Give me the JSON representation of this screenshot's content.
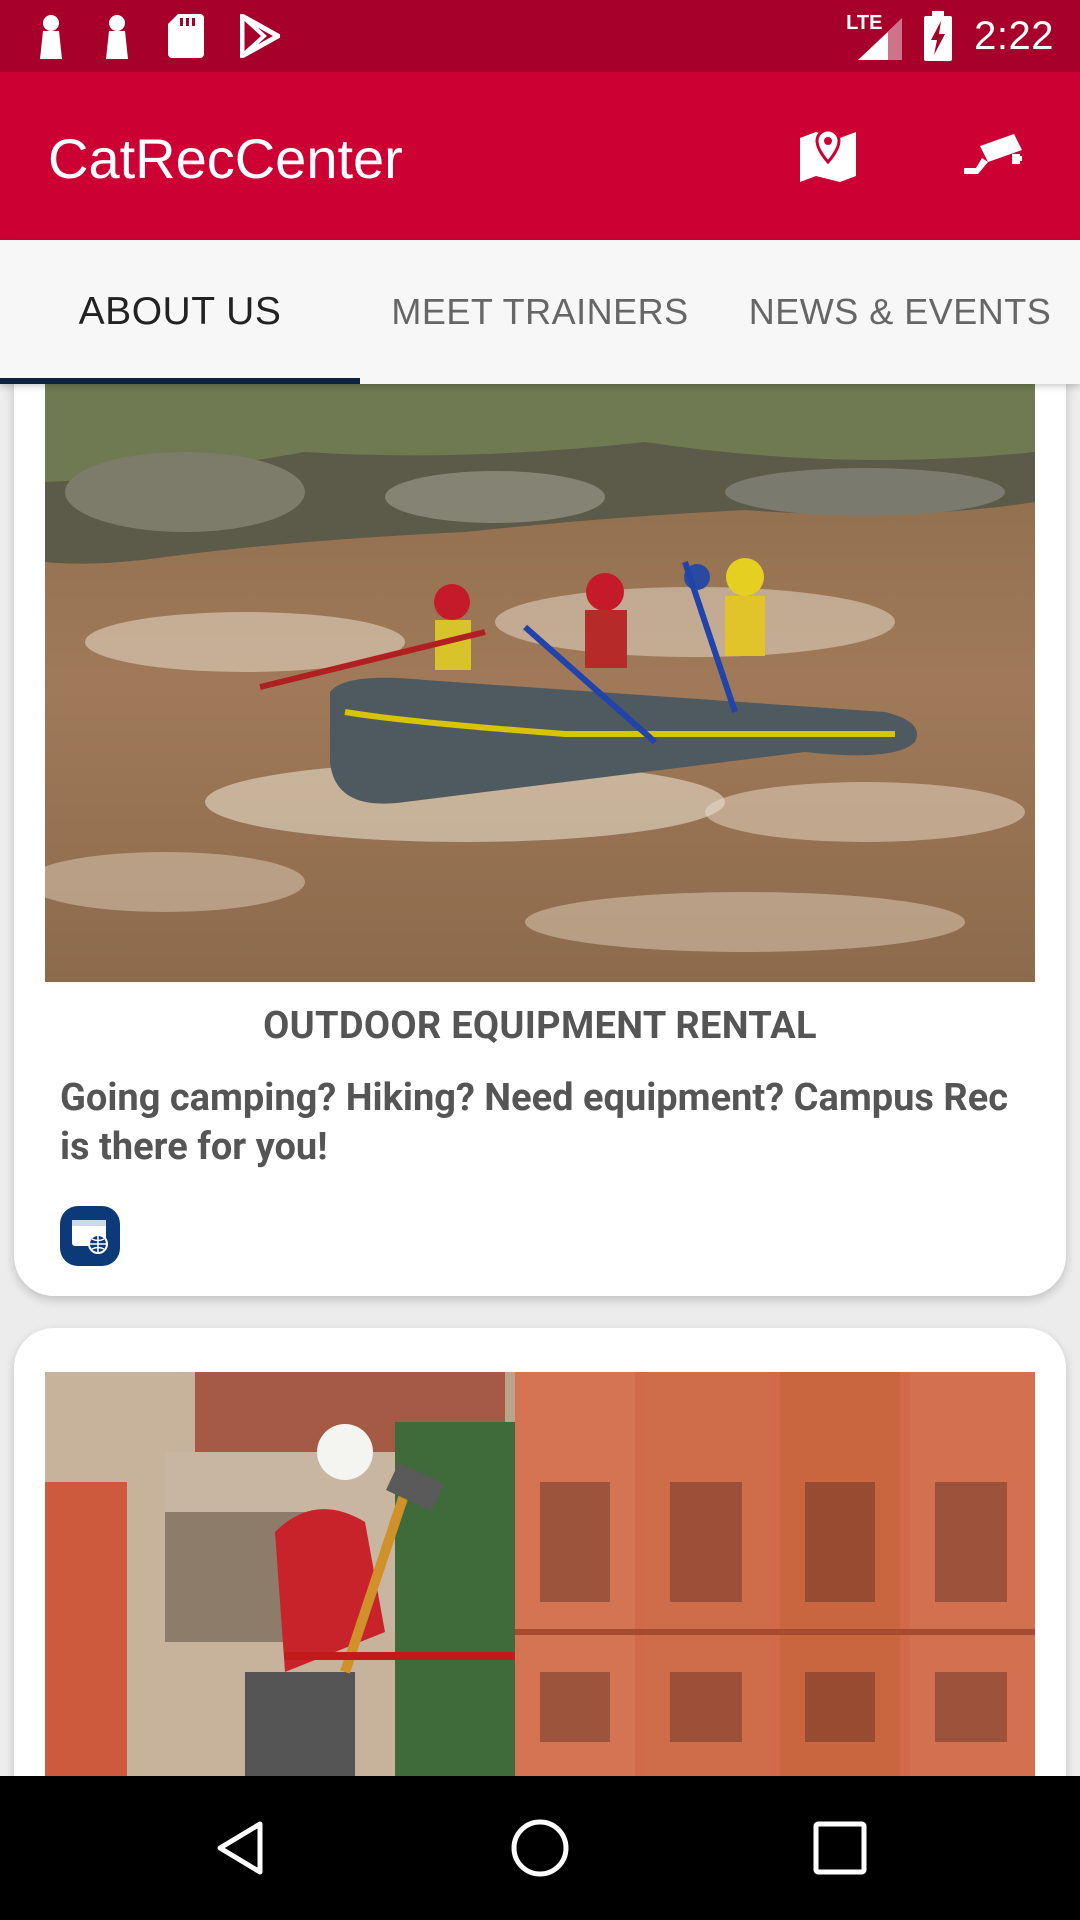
{
  "status_bar": {
    "time": "2:22",
    "network": "LTE",
    "icons": [
      "notification-icon",
      "notification-icon",
      "sd-card-icon",
      "play-store-icon",
      "signal-icon",
      "battery-charging-icon"
    ]
  },
  "app_bar": {
    "title": "CatRecCenter",
    "actions": [
      "map-location-icon",
      "security-camera-icon"
    ]
  },
  "tabs": [
    {
      "label": "ABOUT US",
      "active": true
    },
    {
      "label": "MEET TRAINERS",
      "active": false
    },
    {
      "label": "NEWS & EVENTS",
      "active": false
    }
  ],
  "cards": [
    {
      "image": "rafting-photo",
      "title": "OUTDOOR EQUIPMENT RENTAL",
      "description": "Going camping? Hiking? Need equipment? Campus Rec is there for you!",
      "action_icon": "website-icon"
    },
    {
      "image": "lockers-photo"
    }
  ],
  "nav_bar": [
    "back-icon",
    "home-icon",
    "recents-icon"
  ],
  "colors": {
    "status_bar": "#a7002a",
    "app_bar": "#cc0033",
    "tab_indicator": "#0c2340",
    "web_button": "#0c3a78"
  }
}
